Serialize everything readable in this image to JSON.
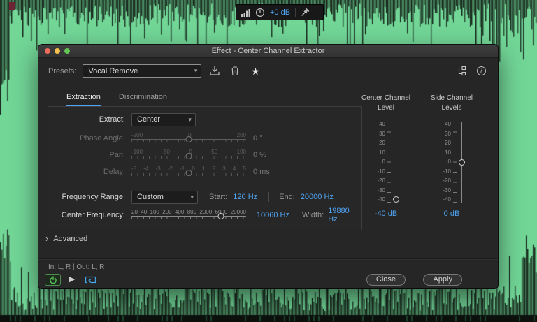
{
  "colors": {
    "accent_blue": "#4FA3F2",
    "background_green": "#72D697",
    "power_green": "#55C855"
  },
  "overlay_toolbar": {
    "db_value": "+0 dB"
  },
  "dialog": {
    "title": "Effect - Center Channel Extractor",
    "presets": {
      "label": "Presets:",
      "value": "Vocal Remove"
    },
    "tabs": {
      "extraction": "Extraction",
      "discrimination": "Discrimination"
    },
    "extraction": {
      "extract_label": "Extract:",
      "extract_value": "Center",
      "phase_angle": {
        "label": "Phase Angle:",
        "ticks": [
          "-200",
          "0",
          "200"
        ],
        "value": "0 °"
      },
      "pan": {
        "label": "Pan:",
        "ticks": [
          "-100",
          "-50",
          "0",
          "50",
          "100"
        ],
        "value": "0 %"
      },
      "delay": {
        "label": "Delay:",
        "ticks": [
          "-5",
          "-4",
          "-3",
          "-2",
          "-1",
          "0",
          "1",
          "2",
          "3",
          "4",
          "5"
        ],
        "value": "0 ms"
      },
      "frequency_range": {
        "label": "Frequency Range:",
        "value": "Custom",
        "start_label": "Start:",
        "start_value": "120 Hz",
        "end_label": "End:",
        "end_value": "20000 Hz"
      },
      "center_frequency": {
        "label": "Center Frequency:",
        "ticks": [
          "20",
          "40",
          "100",
          "200",
          "400",
          "800",
          "2000",
          "6000",
          "20000"
        ],
        "value": "10060 Hz",
        "width_label": "Width:",
        "width_value": "19880 Hz"
      }
    },
    "meters": {
      "center": {
        "title": "Center Channel Level",
        "ticks": [
          "40",
          "30",
          "20",
          "10",
          "0",
          "-10",
          "-20",
          "-30",
          "-40"
        ],
        "value": "-40 dB"
      },
      "side": {
        "title": "Side Channel Levels",
        "ticks": [
          "40",
          "30",
          "20",
          "10",
          "0",
          "-10",
          "-20",
          "-30",
          "-40"
        ],
        "value": "0 dB"
      }
    },
    "advanced_label": "Advanced",
    "io_text": "In: L, R | Out: L, R",
    "buttons": {
      "close": "Close",
      "apply": "Apply"
    }
  },
  "icons": {
    "star": "★",
    "chevron_down": "▾",
    "advanced_chevron": "›",
    "play": "▶",
    "info": "i"
  }
}
